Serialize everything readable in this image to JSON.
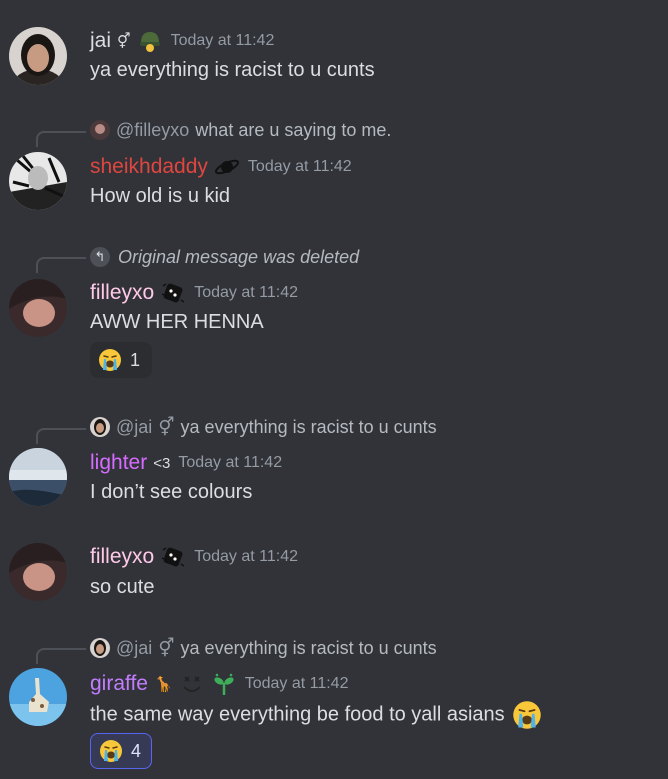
{
  "colors": {
    "background": "#313338",
    "text": "#dbdee1",
    "muted": "#949ba4",
    "reaction_me_border": "#5865f2"
  },
  "messages": [
    {
      "username": "jai",
      "username_suffix": "⚥",
      "username_color": "#dbdee1",
      "timestamp": "Today at 11:42",
      "content": "ya everything is racist to u cunts"
    },
    {
      "reply": {
        "name": "@filleyxo",
        "text": "what are u saying to me."
      },
      "username": "sheikhdaddy",
      "username_color": "#e0463f",
      "timestamp": "Today at 11:42",
      "content": "How old is u kid"
    },
    {
      "reply": {
        "text": "Original message was deleted"
      },
      "username": "filleyxo",
      "username_color": "#ffc9e9",
      "timestamp": "Today at 11:42",
      "content": "AWW HER HENNA",
      "reaction": {
        "emoji": "crying-face",
        "count": "1"
      }
    },
    {
      "reply": {
        "name": "@jai",
        "name_suffix": "⚥",
        "text": "ya everything is racist to u cunts"
      },
      "username": "lighter",
      "username_tag": "<3",
      "username_color": "#d66bff",
      "timestamp": "Today at 11:42",
      "content": "I don’t see colours"
    },
    {
      "username": "filleyxo",
      "username_color": "#ffc9e9",
      "timestamp": "Today at 11:42",
      "content": "so cute"
    },
    {
      "reply": {
        "name": "@jai",
        "name_suffix": "⚥",
        "text": "ya everything is racist to u cunts"
      },
      "username": "giraffe",
      "username_emoji": "🦒",
      "username_color": "#c27dff",
      "timestamp": "Today at 11:42",
      "content": "the same way everything be food to yall asians",
      "reaction": {
        "emoji": "crying-face",
        "count": "4",
        "me": true
      }
    }
  ]
}
